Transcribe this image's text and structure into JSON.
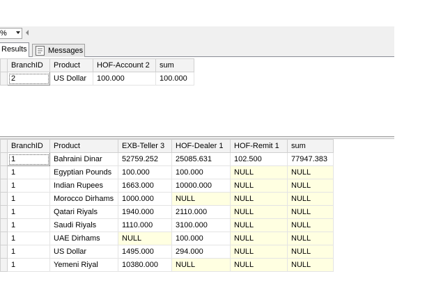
{
  "toolbar": {
    "zoom_value": "%"
  },
  "tabs": {
    "results_label": "Results",
    "messages_label": "Messages"
  },
  "grid1": {
    "columns": [
      "BranchID",
      "Product",
      "HOF-Account 2",
      "sum"
    ],
    "rows": [
      [
        "2",
        "US Dollar",
        "100.000",
        "100.000"
      ]
    ]
  },
  "grid2": {
    "columns": [
      "BranchID",
      "Product",
      "EXB-Teller 3",
      "HOF-Dealer 1",
      "HOF-Remit 1",
      "sum"
    ],
    "rows": [
      [
        "1",
        "Bahraini Dinar",
        "52759.252",
        "25085.631",
        "102.500",
        "77947.383"
      ],
      [
        "1",
        "Egyptian Pounds",
        "100.000",
        "100.000",
        "NULL",
        "NULL"
      ],
      [
        "1",
        "Indian Rupees",
        "1663.000",
        "10000.000",
        "NULL",
        "NULL"
      ],
      [
        "1",
        "Morocco Dirhams",
        "1000.000",
        "NULL",
        "NULL",
        "NULL"
      ],
      [
        "1",
        "Qatari Riyals",
        "1940.000",
        "2110.000",
        "NULL",
        "NULL"
      ],
      [
        "1",
        "Saudi Riyals",
        "1110.000",
        "3100.000",
        "NULL",
        "NULL"
      ],
      [
        "1",
        "UAE Dirhams",
        "NULL",
        "100.000",
        "NULL",
        "NULL"
      ],
      [
        "1",
        "US Dollar",
        "1495.000",
        "294.000",
        "NULL",
        "NULL"
      ],
      [
        "1",
        "Yemeni Riyal",
        "10380.000",
        "NULL",
        "NULL",
        "NULL"
      ]
    ]
  }
}
